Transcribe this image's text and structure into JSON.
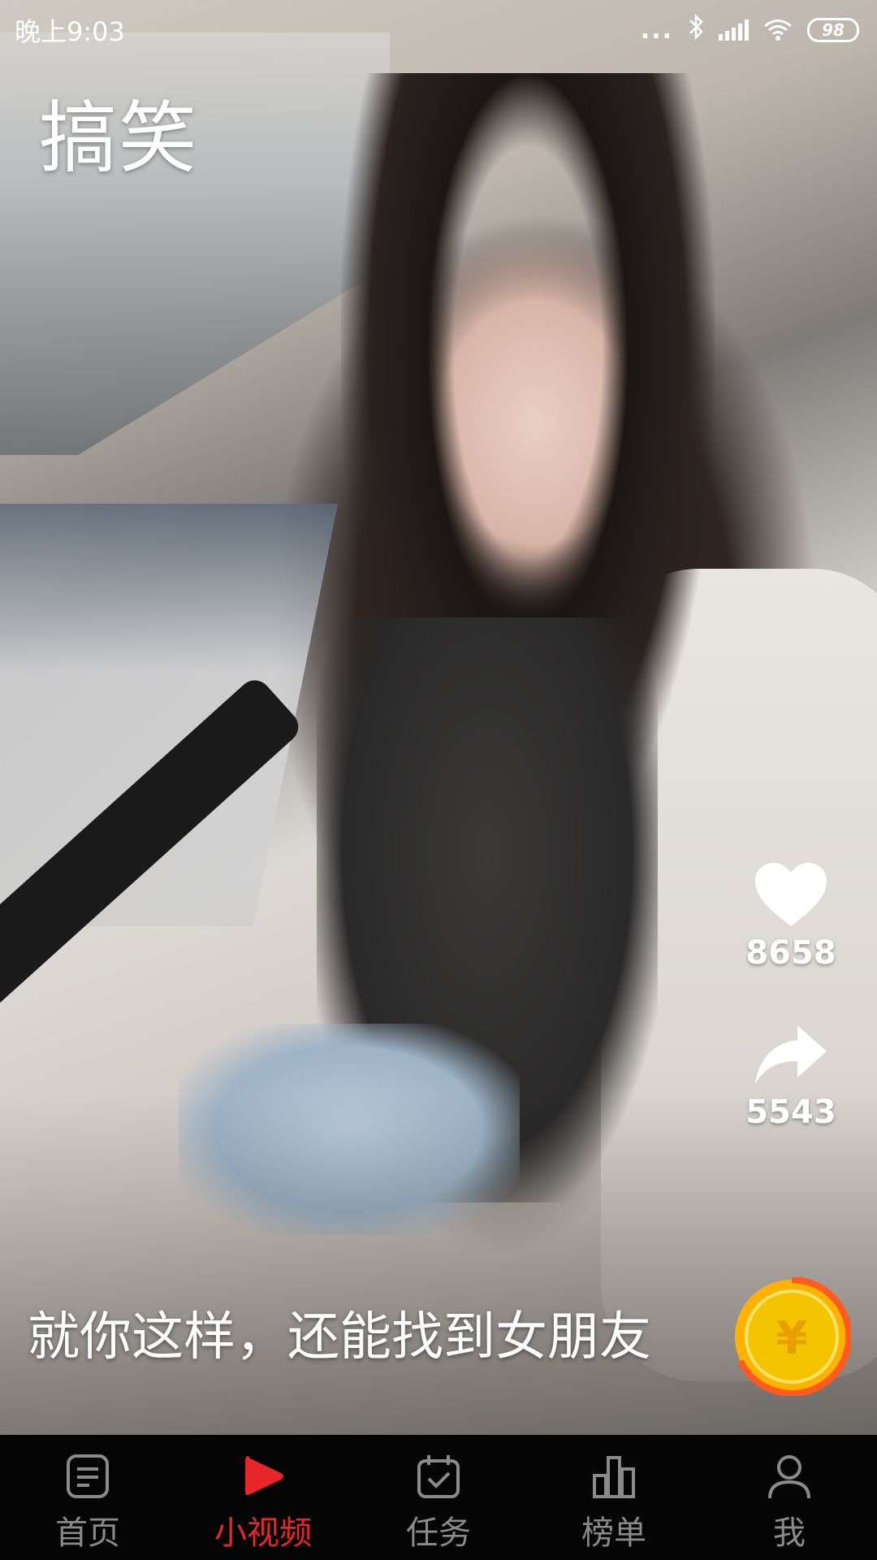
{
  "status_bar": {
    "time": "晚上9:03",
    "dots": "...",
    "battery": "98"
  },
  "category_title": "搞笑",
  "actions": {
    "likes": "8658",
    "shares": "5543"
  },
  "caption": "就你这样，还能找到女朋友",
  "coin_symbol": "¥",
  "tabs": [
    {
      "label": "首页",
      "icon": "document-icon",
      "active": false
    },
    {
      "label": "小视频",
      "icon": "play-icon",
      "active": true
    },
    {
      "label": "任务",
      "icon": "calendar-check-icon",
      "active": false
    },
    {
      "label": "榜单",
      "icon": "bar-chart-icon",
      "active": false
    },
    {
      "label": "我",
      "icon": "user-icon",
      "active": false
    }
  ],
  "colors": {
    "active_tab": "#e8262a",
    "inactive_tab": "#8a8a8a",
    "coin_gold": "#f5c400",
    "coin_ring": "#ff5a1f"
  }
}
